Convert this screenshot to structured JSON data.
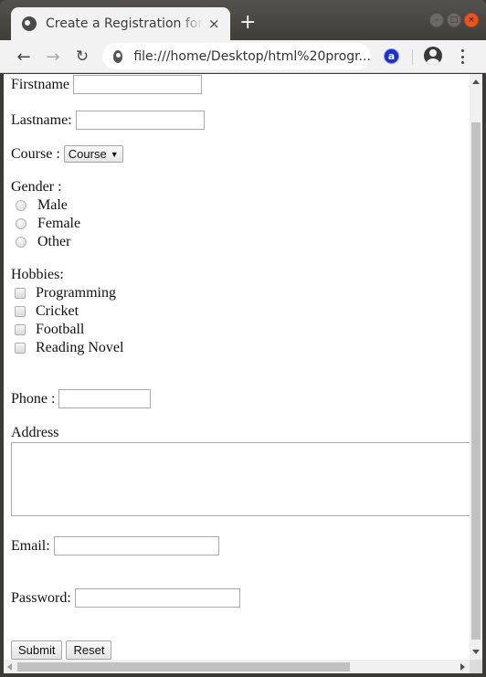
{
  "browser": {
    "tab_title": "Create a Registration form",
    "tab_close_glyph": "×",
    "new_tab_glyph": "+",
    "url": "file:///home/Desktop/html%20progr...",
    "ext_label": "a",
    "window_controls": {
      "minimize": "–",
      "maximize": "□",
      "close": "×"
    },
    "nav": {
      "back": "←",
      "forward": "→",
      "reload": "↻"
    }
  },
  "form": {
    "firstname": {
      "label": "Firstname",
      "value": ""
    },
    "lastname": {
      "label": "Lastname:",
      "value": ""
    },
    "course": {
      "label": "Course :",
      "selected": "Course",
      "caret": "▼"
    },
    "gender": {
      "label": "Gender :",
      "options": [
        "Male",
        "Female",
        "Other"
      ]
    },
    "hobbies": {
      "label": "Hobbies:",
      "options": [
        "Programming",
        "Cricket",
        "Football",
        "Reading Novel"
      ]
    },
    "phone": {
      "label": "Phone :",
      "value": ""
    },
    "address": {
      "label": "Address",
      "value": ""
    },
    "email": {
      "label": "Email:",
      "value": ""
    },
    "password": {
      "label": "Password:",
      "value": ""
    },
    "submit_label": "Submit",
    "reset_label": "Reset"
  }
}
